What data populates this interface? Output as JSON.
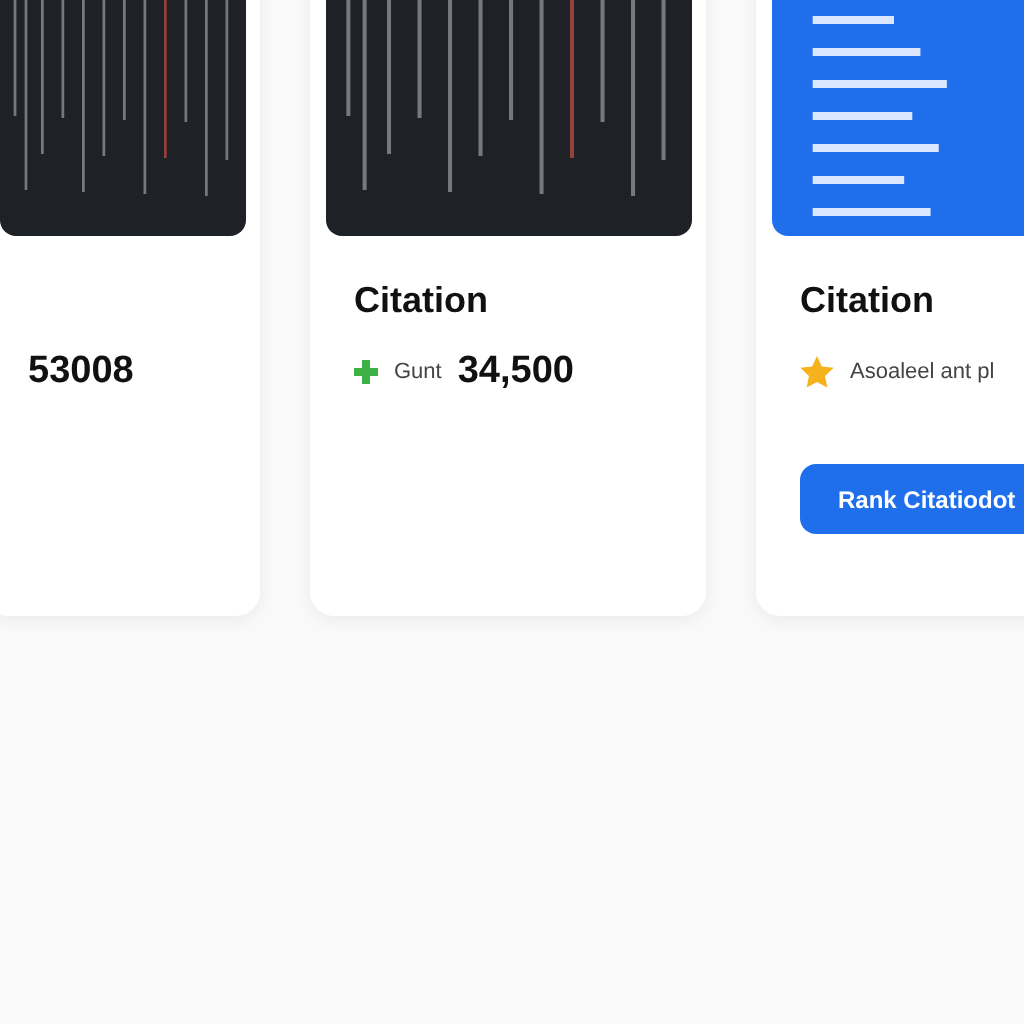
{
  "cards": [
    {
      "kind": "code",
      "stat": {
        "value": "53008"
      }
    },
    {
      "kind": "code",
      "title": "Citation",
      "stat": {
        "kind": "gain",
        "label": "Gunt",
        "value": "34,500"
      }
    },
    {
      "kind": "list",
      "title": "Citation",
      "stat": {
        "kind": "rating",
        "label": "Asoaleel ant pl"
      },
      "button": "Rank Citatiodot"
    }
  ]
}
